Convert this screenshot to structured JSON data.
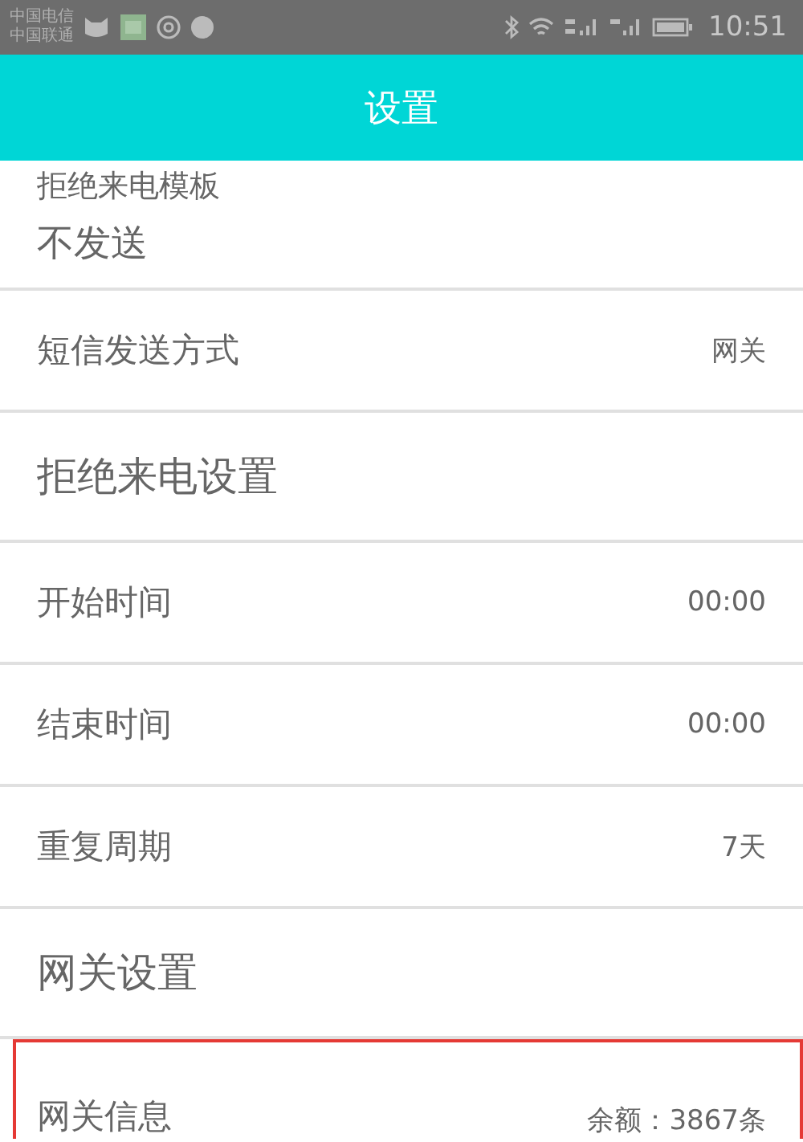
{
  "status_bar": {
    "carriers": [
      "中国电信",
      "中国联通"
    ],
    "time": "10:51"
  },
  "header": {
    "title": "设置"
  },
  "items": [
    {
      "kind": "two_line",
      "label": "拒绝来电模板",
      "value": "不发送",
      "highlighted": false
    },
    {
      "kind": "setting",
      "label": "短信发送方式",
      "value": "网关",
      "highlighted": false
    },
    {
      "kind": "section",
      "label": "拒绝来电设置",
      "highlighted": false
    },
    {
      "kind": "setting",
      "label": "开始时间",
      "value": "00:00",
      "highlighted": false
    },
    {
      "kind": "setting",
      "label": "结束时间",
      "value": "00:00",
      "highlighted": false
    },
    {
      "kind": "setting",
      "label": "重复周期",
      "value": "7天",
      "highlighted": false
    },
    {
      "kind": "section",
      "label": "网关设置",
      "highlighted": false
    },
    {
      "kind": "setting",
      "label": "网关信息",
      "value": "余额：3867条",
      "highlighted": true
    }
  ]
}
